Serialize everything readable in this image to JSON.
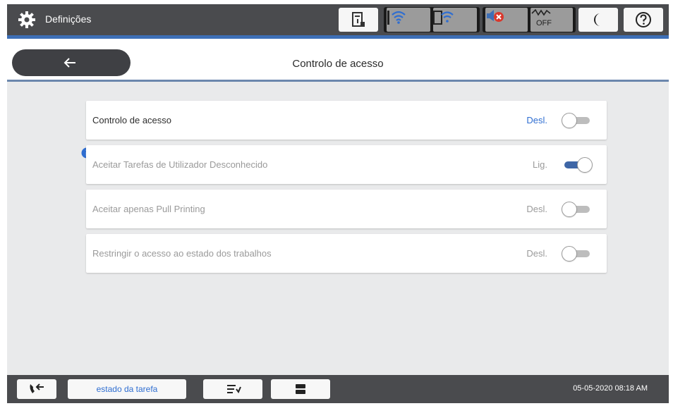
{
  "app": {
    "title": "Definições",
    "icon": "gear-icon"
  },
  "status_bar": {
    "icons": [
      "document-status-icon",
      "wifi-icon",
      "wifi-direct-icon",
      "mute-icon",
      "eco-off-icon",
      "sleep-mode-icon",
      "help-icon"
    ],
    "eco_label": "OFF"
  },
  "header": {
    "back_icon": "arrow-left-icon",
    "title": "Controlo de acesso"
  },
  "settings": [
    {
      "label": "Controlo de acesso",
      "state": "Desl.",
      "on": false,
      "enabled": true
    },
    {
      "label": "Aceitar Tarefas de Utilizador Desconhecido",
      "state": "Lig.",
      "on": true,
      "enabled": false,
      "info_icon": "info-icon"
    },
    {
      "label": "Aceitar apenas Pull Printing",
      "state": "Desl.",
      "on": false,
      "enabled": false
    },
    {
      "label": "Restringir o acesso ao estado dos trabalhos",
      "state": "Desl.",
      "on": false,
      "enabled": false
    }
  ],
  "bottom_bar": {
    "fax_icon": "fax-icon",
    "job_status_label": "estado da tarefa",
    "icons": [
      "data-transfer-icon",
      "copy-icon"
    ],
    "datetime": "05-05-2020 08:18 AM"
  },
  "colors": {
    "topbar": "#4a4b4e",
    "accent": "#3d6fb6",
    "link_text": "#2f6ed1",
    "toggle_on": "#3e66a6"
  }
}
